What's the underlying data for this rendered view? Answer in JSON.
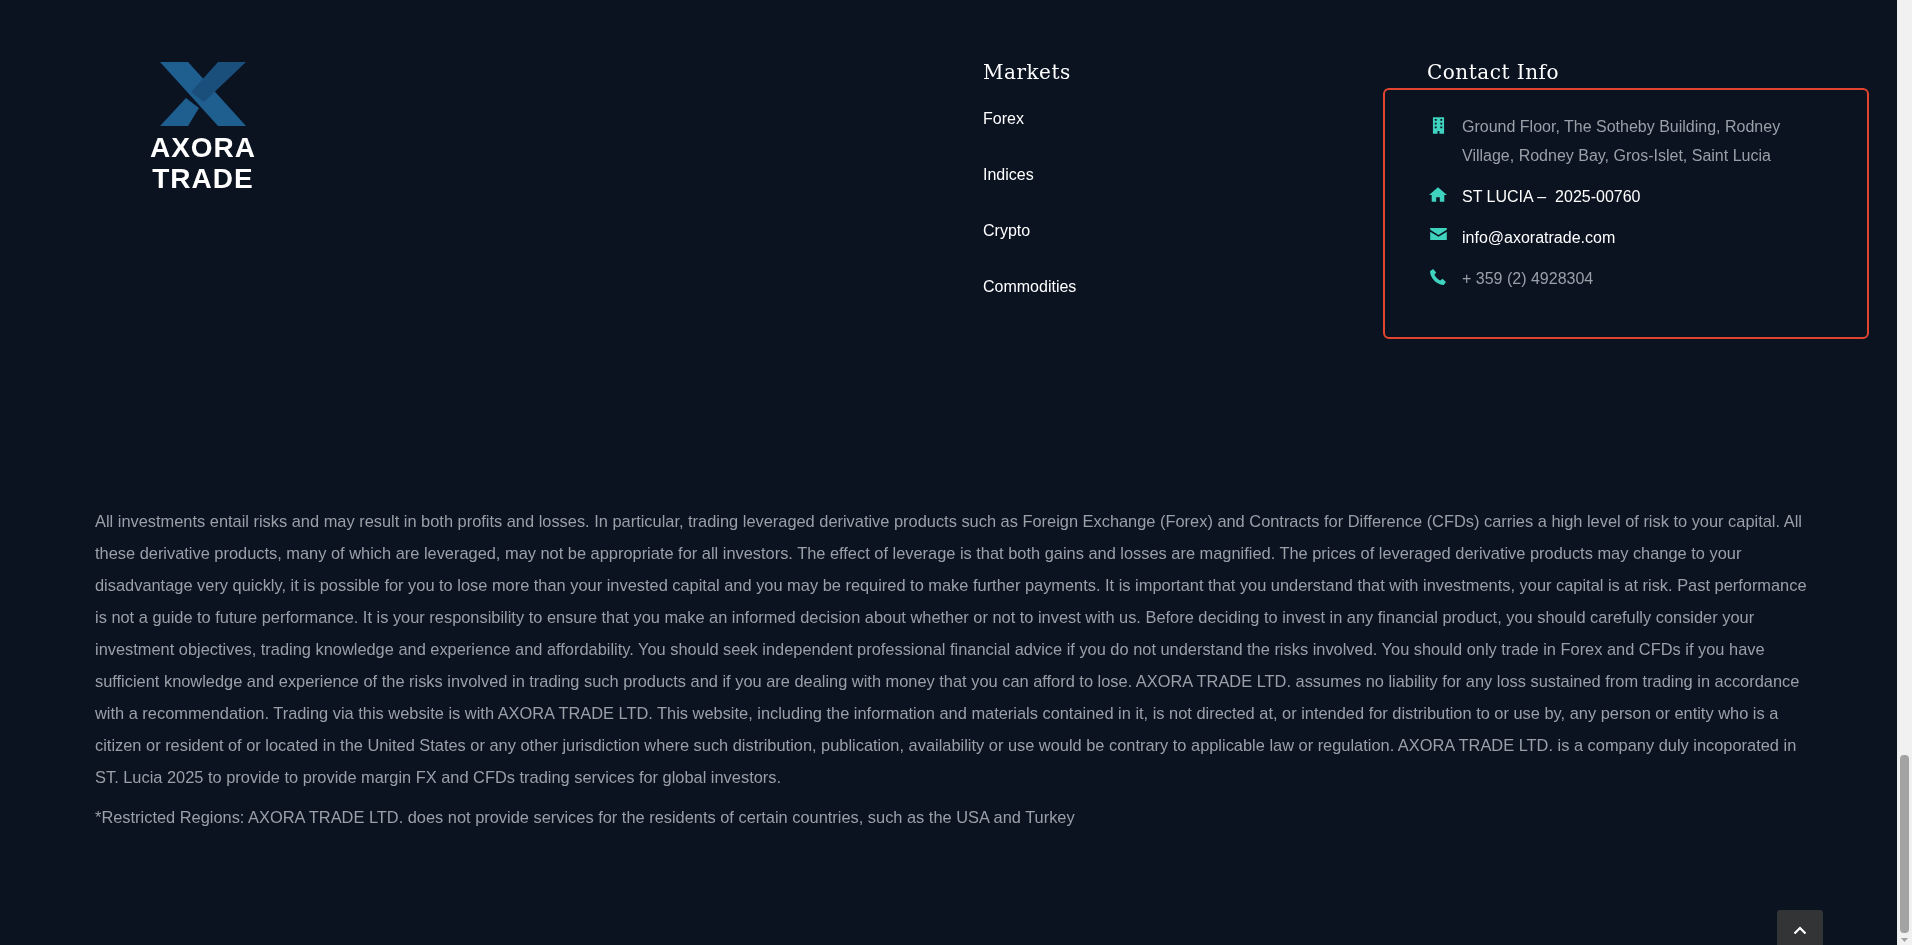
{
  "logo": {
    "line_1": "AXORA",
    "line_2": "TRADE"
  },
  "markets": {
    "heading": "Markets",
    "links": [
      "Forex",
      "Indices",
      "Crypto",
      "Commodities"
    ]
  },
  "contact": {
    "heading": "Contact Info",
    "items": [
      {
        "kind": "address",
        "text": "Ground Floor, The Sotheby Building, Rodney Village, Rodney Bay, Gros-Islet, Saint Lucia"
      },
      {
        "kind": "registration",
        "text": "ST LUCIA –  2025-00760"
      },
      {
        "kind": "email",
        "text": "info@axoratrade.com"
      },
      {
        "kind": "phone",
        "text": "+ 359 (2) 4928304"
      }
    ]
  },
  "disclaimer": {
    "paragraphs": [
      "All investments entail risks and may result in both profits and losses. In particular, trading leveraged derivative products such as Foreign Exchange (Forex) and Contracts for Difference (CFDs) carries a high level of risk to your capital. All these derivative products, many of which are leveraged, may not be appropriate for all investors. The effect of leverage is that both gains and losses are magnified. The prices of leveraged derivative products may change to your disadvantage very quickly, it is possible for you to lose more than your invested capital and you may be required to make further payments. It is important that you understand that with investments, your capital is at risk. Past performance is not a guide to future performance. It is your responsibility to ensure that you make an informed decision about whether or not to invest with us. Before deciding to invest in any financial product, you should carefully consider your investment objectives, trading knowledge and experience and affordability. You should seek independent professional financial advice if you do not understand the risks involved. You should only trade in Forex and CFDs if you have sufficient knowledge and experience of the risks involved in trading such products and if you are dealing with money that you can afford to lose. AXORA TRADE LTD. assumes no liability for any loss sustained from trading in accordance with a recommendation. Trading via this website is with AXORA TRADE LTD. This website, including the information and materials contained in it, is not directed at, or intended for distribution to or use by, any person or entity who is a citizen or resident of or located in the United States or any other jurisdiction where such distribution, publication, availability or use would be contrary to applicable law or regulation. AXORA TRADE LTD. is a company duly incoporated in ST. Lucia 2025 to provide to provide margin FX and CFDs trading services for global investors.",
      "*Restricted Regions: AXORA TRADE LTD. does not provide services for the residents of certain countries, such as the USA and Turkey"
    ]
  }
}
